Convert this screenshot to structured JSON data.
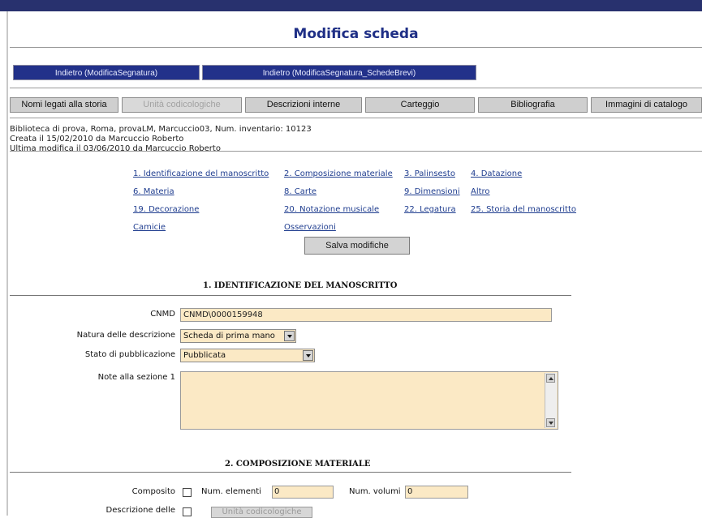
{
  "page_title": "Modifica scheda",
  "nav_buttons": [
    "Indietro (ModificaSegnatura)",
    "Indietro (ModificaSegnatura_SchedeBrevi)"
  ],
  "tabs": [
    {
      "label": "Nomi legati alla storia",
      "enabled": true
    },
    {
      "label": "Unità codicologiche",
      "enabled": false
    },
    {
      "label": "Descrizioni interne",
      "enabled": true
    },
    {
      "label": "Carteggio",
      "enabled": true
    },
    {
      "label": "Bibliografia",
      "enabled": true
    },
    {
      "label": "Immagini di catalogo",
      "enabled": true
    }
  ],
  "info": [
    "Biblioteca di prova, Roma, provaLM, Marcuccio03, Num. inventario: 10123",
    "Creata il 15/02/2010 da Marcuccio Roberto",
    "Ultima modifica il 03/06/2010 da Marcuccio Roberto"
  ],
  "section_links": [
    [
      "1. Identificazione del manoscritto",
      "2. Composizione materiale",
      "3. Palinsesto",
      "4. Datazione"
    ],
    [
      "6. Materia",
      "8. Carte",
      "9. Dimensioni",
      "Altro"
    ],
    [
      "19. Decorazione",
      "20. Notazione musicale",
      "22. Legatura",
      "25. Storia del manoscritto"
    ],
    [
      "Camicie",
      "Osservazioni"
    ]
  ],
  "save_button": "Salva modifiche",
  "section1": {
    "title": "1. IDENTIFICAZIONE DEL MANOSCRITTO",
    "cnmd_label": "CNMD",
    "cnmd_value": "CNMD\\0000159948",
    "natura_label": "Natura delle descrizione",
    "natura_value": "Scheda di prima mano",
    "stato_label": "Stato di pubblicazione",
    "stato_value": "Pubblicata",
    "note_label": "Note alla sezione 1",
    "note_value": ""
  },
  "section2": {
    "title": "2. COMPOSIZIONE MATERIALE",
    "composito_label": "Composito",
    "num_elementi_label": "Num. elementi",
    "num_elementi_value": "0",
    "num_volumi_label": "Num. volumi",
    "num_volumi_value": "0",
    "descrizione_label": "Descrizione delle",
    "unita_button": "Unità codicologiche"
  }
}
